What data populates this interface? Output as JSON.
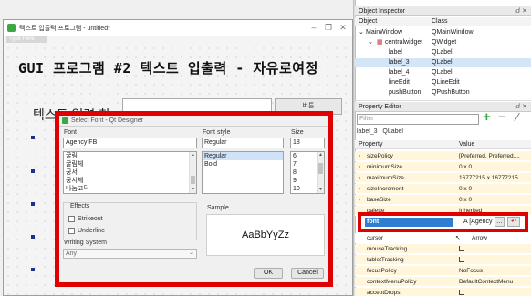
{
  "designer": {
    "window_title": "텍스트 입출력 프로그램 - untitled*",
    "type_here": "Type Here",
    "heading": "GUI 프로그램 #2 텍스트 입출력 - 자유로여정",
    "text_label": "텍스트 입력 창",
    "push_button": "버튼"
  },
  "font_dialog": {
    "title": "Select Font - Qt Designer",
    "font_label": "Font",
    "font_value": "Agency FB",
    "font_list": [
      "굴림",
      "굴림체",
      "궁서",
      "궁서체",
      "나눔고딕"
    ],
    "style_label": "Font style",
    "style_value": "Regular",
    "style_list": [
      "Regular",
      "Bold"
    ],
    "size_label": "Size",
    "size_value": "18",
    "size_list": [
      "6",
      "7",
      "8",
      "9",
      "10"
    ],
    "effects_label": "Effects",
    "strikeout_label": "Strikeout",
    "underline_label": "Underline",
    "writing_system_label": "Writing System",
    "writing_system_value": "Any",
    "sample_label": "Sample",
    "sample_text": "AaBbYyZz",
    "ok_label": "OK",
    "cancel_label": "Cancel"
  },
  "object_inspector": {
    "title": "Object Inspector",
    "col_object": "Object",
    "col_class": "Class",
    "rows": [
      {
        "object": "MainWindow",
        "class": "QMainWindow"
      },
      {
        "object": "centralwidget",
        "class": "QWidget"
      },
      {
        "object": "label",
        "class": "QLabel"
      },
      {
        "object": "label_3",
        "class": "QLabel"
      },
      {
        "object": "label_4",
        "class": "QLabel"
      },
      {
        "object": "lineEdit",
        "class": "QLineEdit"
      },
      {
        "object": "pushButton",
        "class": "QPushButton"
      }
    ]
  },
  "property_editor": {
    "title": "Property Editor",
    "filter_placeholder": "Filter",
    "context": "label_3 : QLabel",
    "col_property": "Property",
    "col_value": "Value",
    "rows": [
      {
        "name": "sizePolicy",
        "value": "[Preferred, Preferred,..."
      },
      {
        "name": "minimumSize",
        "value": "0 x 0"
      },
      {
        "name": "maximumSize",
        "value": "16777215 x 16777215"
      },
      {
        "name": "sizeIncrement",
        "value": "0 x 0"
      },
      {
        "name": "baseSize",
        "value": "0 x 0"
      },
      {
        "name": "palette",
        "value": "Inherited"
      }
    ],
    "font_row": {
      "name": "font",
      "value": "A [Agency FB"
    },
    "rows_after": [
      {
        "name": "cursor",
        "value": "Arrow"
      },
      {
        "name": "mouseTracking",
        "value": ""
      },
      {
        "name": "tabletTracking",
        "value": ""
      },
      {
        "name": "focusPolicy",
        "value": "NoFocus"
      },
      {
        "name": "contextMenuPolicy",
        "value": "DefaultContextMenu"
      },
      {
        "name": "acceptDrops",
        "value": ""
      }
    ]
  },
  "colors": {
    "highlight_red": "#e00000",
    "selection_blue": "#2f7dd1",
    "property_row_tint": "#fff6dc"
  }
}
